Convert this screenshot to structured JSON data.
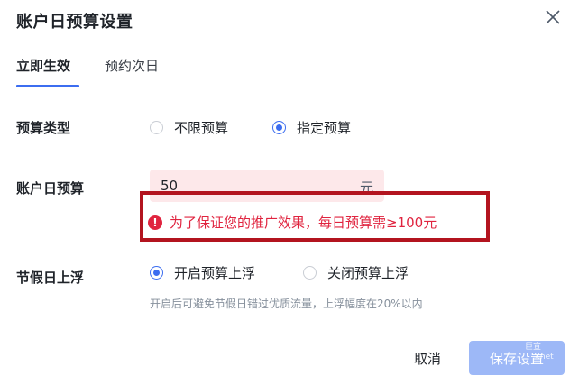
{
  "dialog": {
    "title": "账户日预算设置"
  },
  "tabs": [
    {
      "label": "立即生效",
      "active": true
    },
    {
      "label": "预约次日",
      "active": false
    }
  ],
  "budget_type": {
    "label": "预算类型",
    "options": [
      {
        "label": "不限预算",
        "checked": false
      },
      {
        "label": "指定预算",
        "checked": true
      }
    ]
  },
  "daily_budget": {
    "label": "账户日预算",
    "value": "50",
    "unit": "元",
    "error": "为了保证您的推广效果，每日预算需≥100元"
  },
  "holiday_float": {
    "label": "节假日上浮",
    "options": [
      {
        "label": "开启预算上浮",
        "checked": true
      },
      {
        "label": "关闭预算上浮",
        "checked": false
      }
    ],
    "hint": "开启后可避免节假日错过优质流量，上浮幅度在20%以内"
  },
  "footer": {
    "cancel_label": "取消",
    "save_label": "保存设置"
  },
  "watermark": {
    "line1": "巨宣",
    "line2": ".net"
  },
  "colors": {
    "accent": "#3c6df0",
    "error": "#e0243f",
    "annotation_box": "#b3141f",
    "save_button": "#9db8f7",
    "input_error_bg": "#fde8ea"
  }
}
